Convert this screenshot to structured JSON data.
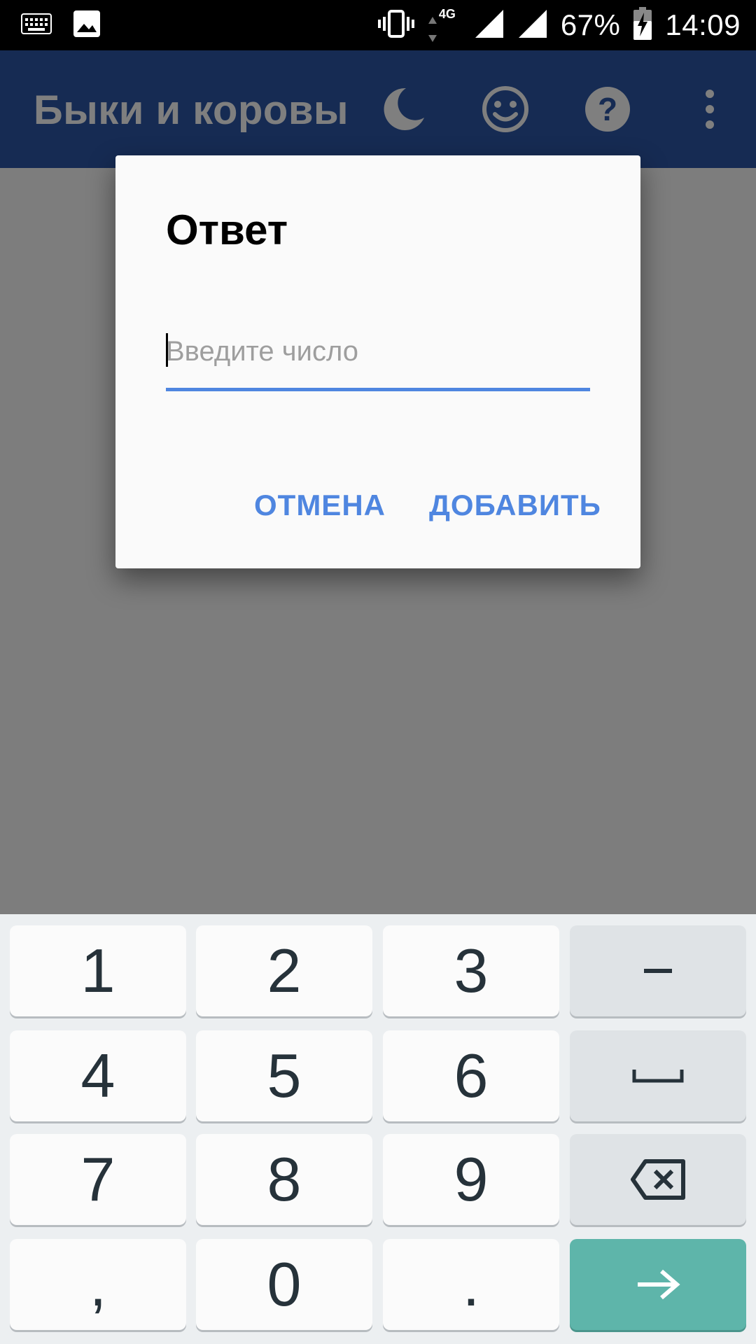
{
  "status_bar": {
    "battery": "67%",
    "time": "14:09",
    "network_label": "4G",
    "icons": [
      "keyboard-icon",
      "image-icon",
      "vibrate-icon",
      "data-arrows-icon",
      "signal-icon",
      "signal-icon",
      "battery-charging-icon"
    ]
  },
  "app_bar": {
    "title": "Быки и коровы",
    "actions": [
      "moon-icon",
      "smiley-icon",
      "help-icon",
      "overflow-menu-icon"
    ]
  },
  "dialog": {
    "title": "Ответ",
    "input_placeholder": "Введите число",
    "input_value": "",
    "cancel_label": "ОТМЕНА",
    "add_label": "ДОБАВИТЬ"
  },
  "fab": {
    "icon": "plus-icon",
    "symbol": "+"
  },
  "keyboard": {
    "keys": [
      "1",
      "2",
      "3",
      "−",
      "4",
      "5",
      "6",
      "␣",
      "7",
      "8",
      "9",
      "⌫",
      ",",
      "0",
      ".",
      "→"
    ],
    "function_icons": [
      "minus-icon",
      "space-icon",
      "backspace-icon",
      "enter-arrow-icon"
    ]
  },
  "colors": {
    "primary": "#2c57a6",
    "accent": "#4f86e0",
    "enter_key": "#5eb5aa",
    "keyboard_bg": "#eceff1"
  }
}
